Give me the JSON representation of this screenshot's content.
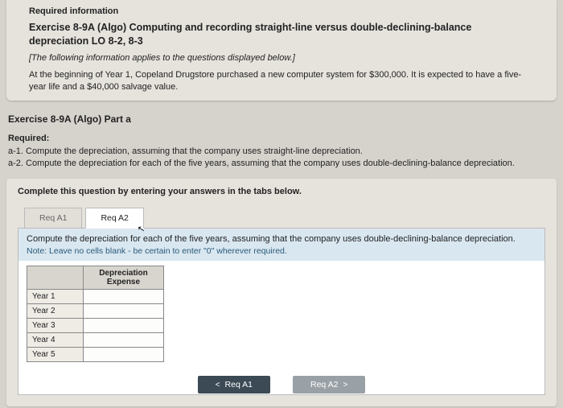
{
  "header": {
    "required_info": "Required information",
    "title": "Exercise 8-9A (Algo) Computing and recording straight-line versus double-declining-balance depreciation LO 8-2, 8-3",
    "italic_note": "[The following information applies to the questions displayed below.]",
    "body": "At the beginning of Year 1, Copeland Drugstore purchased a new computer system for $300,000. It is expected to have a five-year life and a $40,000 salvage value."
  },
  "part_title": "Exercise 8-9A (Algo) Part a",
  "required": {
    "heading": "Required:",
    "a1": "a-1. Compute the depreciation, assuming that the company uses straight-line depreciation.",
    "a2": "a-2. Compute the depreciation for each of the five years, assuming that the company uses double-declining-balance depreciation."
  },
  "instruction": "Complete this question by entering your answers in the tabs below.",
  "tabs": {
    "a1": "Req A1",
    "a2": "Req A2"
  },
  "panel": {
    "prompt": "Compute the depreciation for each of the five years, assuming that the company uses double-declining-balance depreciation.",
    "note": "Note: Leave no cells blank - be certain to enter \"0\" wherever required."
  },
  "table": {
    "col_header": "Depreciation Expense",
    "rows": [
      "Year 1",
      "Year 2",
      "Year 3",
      "Year 4",
      "Year 5"
    ]
  },
  "nav": {
    "prev": "Req A1",
    "next": "Req A2"
  },
  "glyphs": {
    "left": "<",
    "right": ">"
  }
}
